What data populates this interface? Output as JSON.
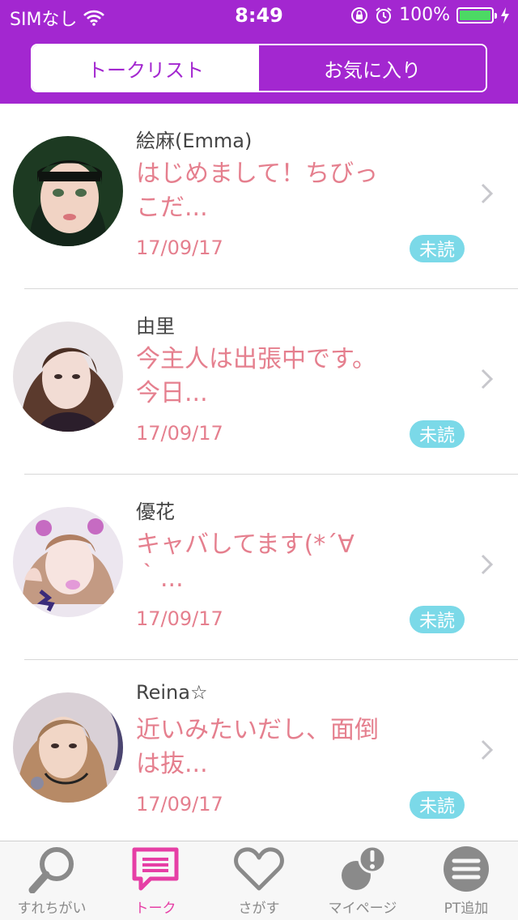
{
  "status_bar": {
    "carrier": "SIMなし",
    "time": "8:49",
    "battery": "100%"
  },
  "segments": [
    {
      "label": "トークリスト",
      "active": true
    },
    {
      "label": "お気に入り",
      "active": false
    }
  ],
  "conversations": [
    {
      "name": "絵麻(Emma)",
      "message": "はじめまして！ちびっこだ...",
      "date": "17/09/17",
      "badge": "未読"
    },
    {
      "name": "由里",
      "message": "今主人は出張中です。今日...",
      "date": "17/09/17",
      "badge": "未読"
    },
    {
      "name": "優花",
      "message": "キャバしてます(*´∀｀...",
      "date": "17/09/17",
      "badge": "未読"
    },
    {
      "name": "Reina☆",
      "message": "近いみたいだし、面倒は抜...",
      "date": "17/09/17",
      "badge": "未読"
    }
  ],
  "tabs": [
    {
      "label": "すれちがい",
      "icon": "magnifier-icon"
    },
    {
      "label": "トーク",
      "icon": "chat-icon",
      "active": true
    },
    {
      "label": "さがす",
      "icon": "heart-icon"
    },
    {
      "label": "マイページ",
      "icon": "profile-alert-icon"
    },
    {
      "label": "PT追加",
      "icon": "menu-icon"
    }
  ],
  "colors": {
    "header": "#a327d0",
    "message_text": "#e57f8e",
    "badge": "#7bd9e8",
    "active_tab": "#e63fa5",
    "battery": "#4cd964"
  }
}
